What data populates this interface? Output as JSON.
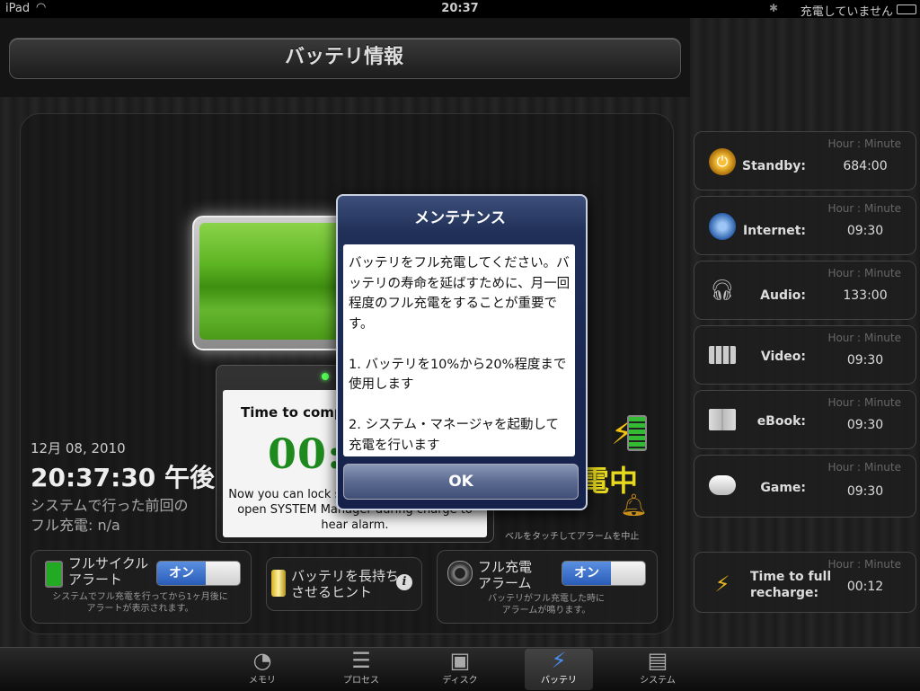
{
  "status_bar": {
    "device": "iPad",
    "time": "20:37",
    "charging_status": "充電していません"
  },
  "header": {
    "title": "バッテリ情報"
  },
  "timer": {
    "title": "Time to comp",
    "digits": "00:",
    "message": "Now you can lock screen. You need to keep open SYSTEM Manager during charge to hear alarm."
  },
  "info": {
    "date": "12月 08, 2010",
    "clock": "20:37:30 午後",
    "last_full_line1": "システムで行った前回の",
    "last_full_line2": "フル充電: n/a"
  },
  "charging": {
    "label": "充電中",
    "bell_hint": "ベルをタッチしてアラームを中止"
  },
  "panels": {
    "full_cycle": {
      "title_line1": "フルサイクル",
      "title_line2": "アラート",
      "toggle": "オン",
      "sub_line1": "システムでフル充電を行ってから1ヶ月後に",
      "sub_line2": "アラートが表示されます。"
    },
    "hint": {
      "title_line1": "バッテリを長持ち",
      "title_line2": "させるヒント",
      "info_glyph": "i"
    },
    "full_charge_alarm": {
      "title_line1": "フル充電",
      "title_line2": "アラーム",
      "toggle": "オン",
      "sub_line1": "バッテリがフル充電した時に",
      "sub_line2": "アラームが鳴ります。"
    }
  },
  "usage": {
    "unit_label": "Hour : Minute",
    "items": [
      {
        "label": "Standby:",
        "value": "684:00",
        "icon": "power-icon"
      },
      {
        "label": "Internet:",
        "value": "09:30",
        "icon": "globe-icon"
      },
      {
        "label": "Audio:",
        "value": "133:00",
        "icon": "headphones-icon"
      },
      {
        "label": "Video:",
        "value": "09:30",
        "icon": "film-icon"
      },
      {
        "label": "eBook:",
        "value": "09:30",
        "icon": "book-icon"
      },
      {
        "label": "Game:",
        "value": "09:30",
        "icon": "gamepad-icon"
      }
    ],
    "recharge": {
      "label_line1": "Time to full",
      "label_line2": "recharge:",
      "value": "00:12",
      "icon": "recharge-icon"
    }
  },
  "dialog": {
    "title": "メンテナンス",
    "body": "バッテリをフル充電してください。バッテリの寿命を延ばすために、月一回程度のフル充電をすることが重要です。\n\n1. バッテリを10%から20%程度まで使用します\n\n2. システム・マネージャを起動して充電を行います",
    "ok_label": "OK"
  },
  "tabs": [
    {
      "label": "メモリ",
      "icon": "memory-icon",
      "active": false
    },
    {
      "label": "プロセス",
      "icon": "process-list-icon",
      "active": false
    },
    {
      "label": "ディスク",
      "icon": "disk-icon",
      "active": false
    },
    {
      "label": "バッテリ",
      "icon": "bolt-icon",
      "active": true
    },
    {
      "label": "システム",
      "icon": "computer-icon",
      "active": false
    }
  ]
}
